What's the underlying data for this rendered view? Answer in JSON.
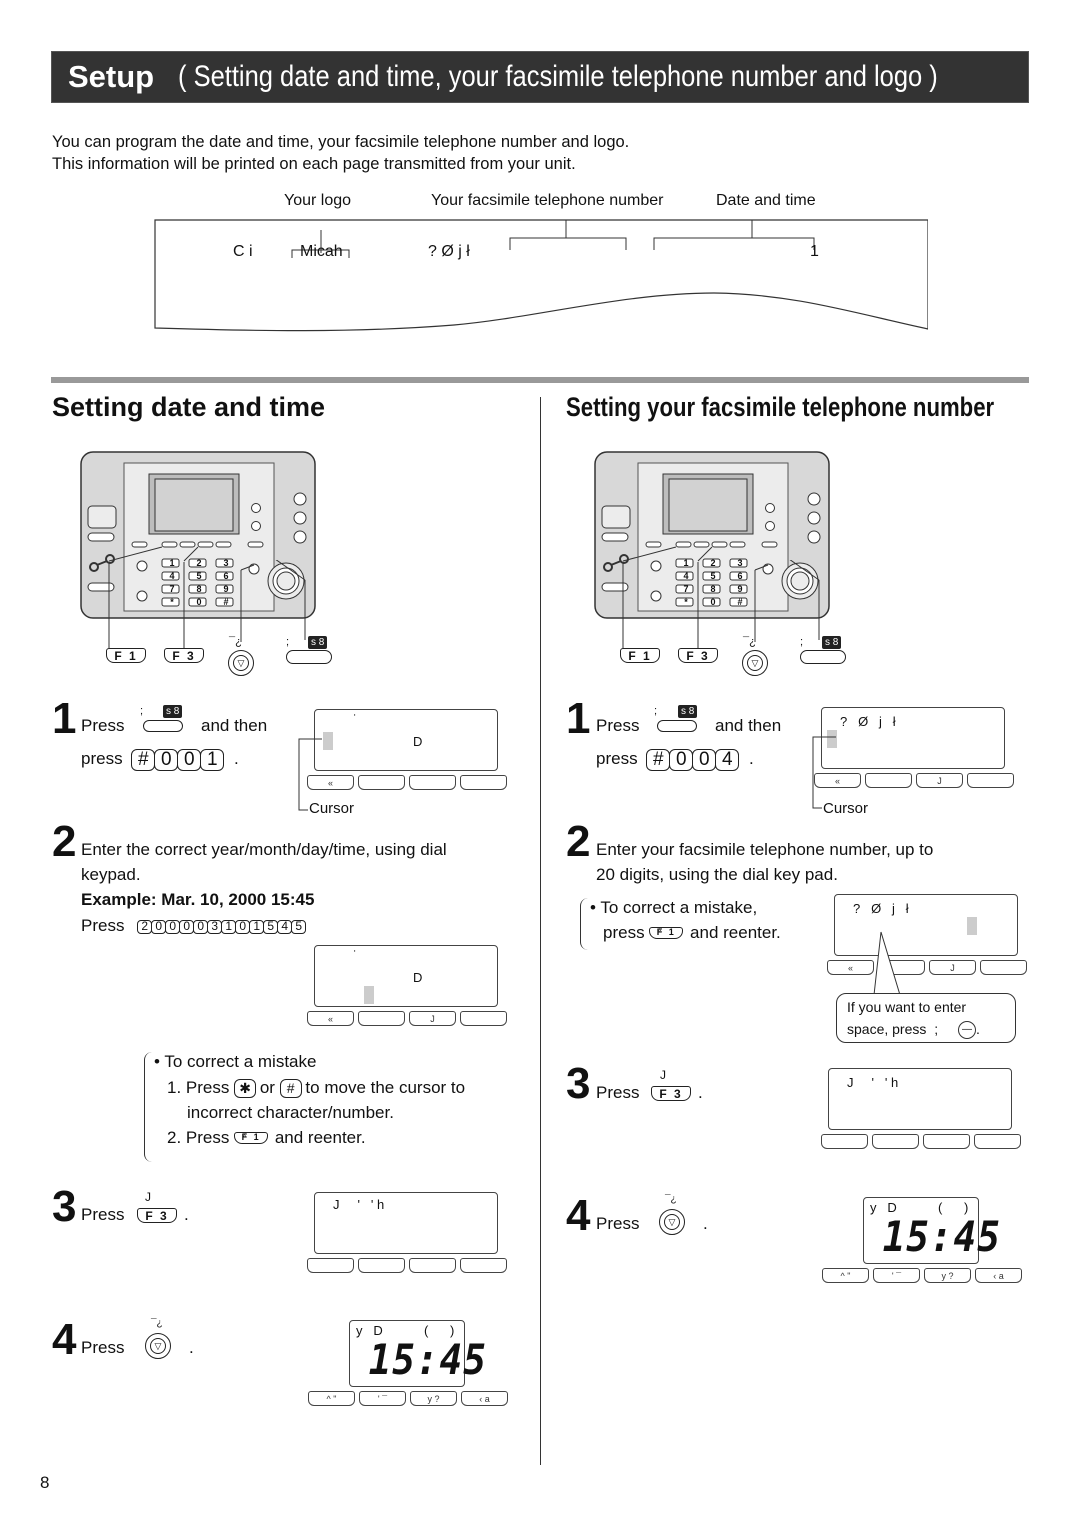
{
  "header": {
    "title_bold": "Setup",
    "title_sub": "( Setting date and time, your facsimile telephone number and logo )"
  },
  "intro": {
    "line1": "You can program the date and time, your facsimile telephone number and logo.",
    "line2": "This information will be printed on each page transmitted from your unit."
  },
  "printout": {
    "labels": {
      "logo": "Your logo",
      "fax_number": "Your facsimile telephone  number",
      "date_time": "Date and time"
    },
    "sample": {
      "from_prefix": "C   i",
      "logo_value": "Micah",
      "fax_prefix": "? Ø j ł",
      "date_end": "1"
    }
  },
  "left_section": {
    "title": "Setting date and time",
    "device_labels": {
      "f1": "F 1",
      "f3": "F 3",
      "stop_sym": "¯¿",
      "menu_sym": ";",
      "menu_badge": "s 8"
    },
    "step1": {
      "num": "1",
      "text_a": "Press",
      "text_b": "and then",
      "text_c": "press",
      "keys": [
        "#",
        "0",
        "0",
        "1"
      ],
      "period": ".",
      "badge": "s 8",
      "badge_sym": ";",
      "lcd": {
        "top": "˙",
        "mid": "D",
        "softkeys": [
          "«",
          "",
          "",
          ""
        ]
      },
      "cursor_label": "Cursor"
    },
    "step2": {
      "num": "2",
      "text": "Enter the correct year/month/day/time, using dial",
      "text2": "keypad.",
      "example": "Example: Mar. 10, 2000   15:45",
      "press": "Press",
      "keys": [
        "2",
        "0",
        "0",
        "0",
        "0",
        "3",
        "1",
        "0",
        "1",
        "5",
        "4",
        "5"
      ],
      "lcd": {
        "top": "˙",
        "mid": "D",
        "softkeys": [
          "«",
          "",
          "J",
          ""
        ]
      }
    },
    "correct": {
      "bullet": "• To correct a mistake",
      "line1a": "1. Press",
      "key_star": "✱",
      "or": "or",
      "key_hash": "#",
      "line1b": "to move the cursor to",
      "line1c": "incorrect character/number.",
      "line2a": "2. Press",
      "f1_sym": "«",
      "f1": "F 1",
      "line2b": "and reenter."
    },
    "step3": {
      "num": "3",
      "text": "Press",
      "key_sym": "J",
      "key": "F 3",
      "period": ".",
      "lcd": {
        "line": "J     '   ' h",
        "softkeys": [
          "",
          "",
          "",
          ""
        ]
      }
    },
    "step4": {
      "num": "4",
      "text": "Press",
      "key_sym": "¯¿",
      "period": ".",
      "lcd": {
        "top_left": "y   D",
        "top_right": "(      )",
        "time": "15:45",
        "softkeys": [
          "^  \"",
          "'  ¯",
          "y  ?",
          "‹     a"
        ]
      }
    }
  },
  "right_section": {
    "title": "Setting your facsimile telephone number",
    "device_labels": {
      "f1": "F 1",
      "f3": "F 3",
      "stop_sym": "¯¿",
      "menu_sym": ";",
      "menu_badge": "s 8"
    },
    "step1": {
      "num": "1",
      "text_a": "Press",
      "text_b": "and then",
      "text_c": "press",
      "keys": [
        "#",
        "0",
        "0",
        "4"
      ],
      "period": ".",
      "badge": "s 8",
      "badge_sym": ";",
      "lcd": {
        "top": "?   Ø   j   ł",
        "softkeys": [
          "«",
          "",
          "J",
          ""
        ]
      },
      "cursor_label": "Cursor"
    },
    "step2": {
      "num": "2",
      "text": "Enter your facsimile telephone number, up to",
      "text2": "20 digits, using the dial key pad.",
      "correct_a": "• To correct a mistake,",
      "correct_b": "press",
      "f1_sym": "«",
      "f1": "F 1",
      "correct_c": "and reenter.",
      "lcd": {
        "top": "?   Ø   j   ł",
        "softkeys": [
          "«",
          "",
          "J",
          ""
        ]
      },
      "callout_a": "If you want to enter",
      "callout_b": "space, press",
      "callout_sym": ";",
      "callout_key": "—"
    },
    "step3": {
      "num": "3",
      "text": "Press",
      "key_sym": "J",
      "key": "F 3",
      "period": ".",
      "lcd": {
        "line": "J     '   ' h",
        "softkeys": [
          "",
          "",
          "",
          ""
        ]
      }
    },
    "step4": {
      "num": "4",
      "text": "Press",
      "key_sym": "¯¿",
      "period": ".",
      "lcd": {
        "top_left": "y   D",
        "top_right": "(      )",
        "time": "15:45",
        "softkeys": [
          "^  \"",
          "'  ¯",
          "y  ?",
          "‹     a"
        ]
      }
    }
  },
  "page_number": "8"
}
